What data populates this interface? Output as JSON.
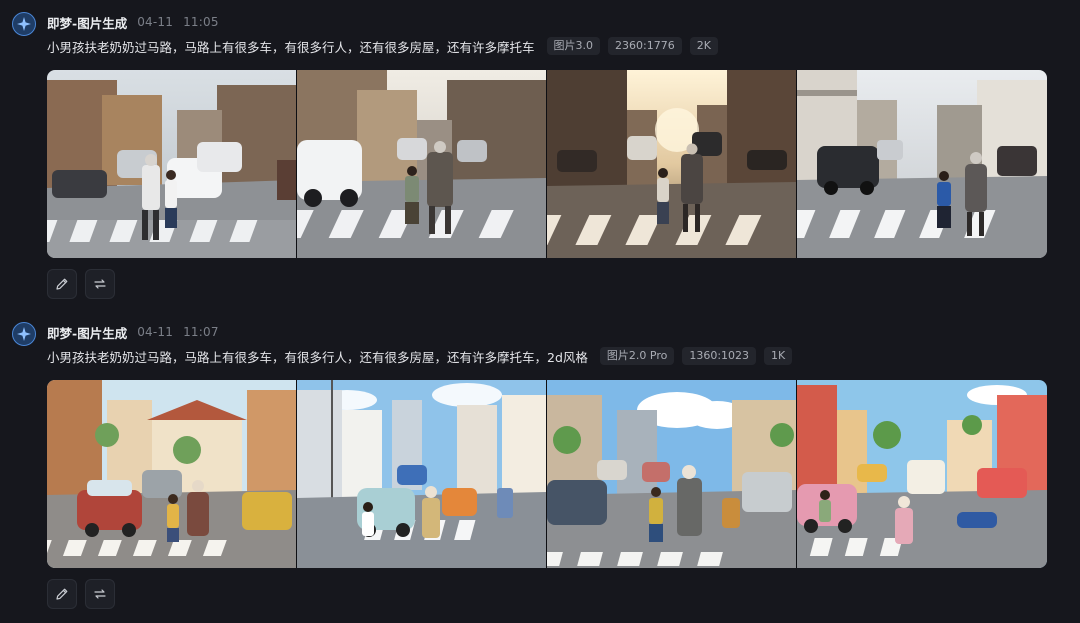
{
  "entries": [
    {
      "app_name": "即梦-图片生成",
      "date": "04-11",
      "time": "11:05",
      "prompt": "小男孩扶老奶奶过马路，马路上有很多车，有很多行人，还有很多房屋，还有许多摩托车",
      "tags": [
        "图片3.0",
        "2360:1776",
        "2K"
      ],
      "style": "photo",
      "images": [
        "generated-image-1",
        "generated-image-2",
        "generated-image-3",
        "generated-image-4"
      ],
      "actions": [
        "edit-icon",
        "regenerate-icon"
      ]
    },
    {
      "app_name": "即梦-图片生成",
      "date": "04-11",
      "time": "11:07",
      "prompt": "小男孩扶老奶奶过马路，马路上有很多车，有很多行人，还有很多房屋，还有许多摩托车，2d风格",
      "tags": [
        "图片2.0 Pro",
        "1360:1023",
        "1K"
      ],
      "style": "anime",
      "images": [
        "generated-image-1",
        "generated-image-2",
        "generated-image-3",
        "generated-image-4"
      ],
      "actions": [
        "edit-icon",
        "regenerate-icon"
      ]
    }
  ],
  "colors": {
    "background": "#16171d",
    "tag_bg": "#23252c",
    "accent": "#4a86d6"
  }
}
